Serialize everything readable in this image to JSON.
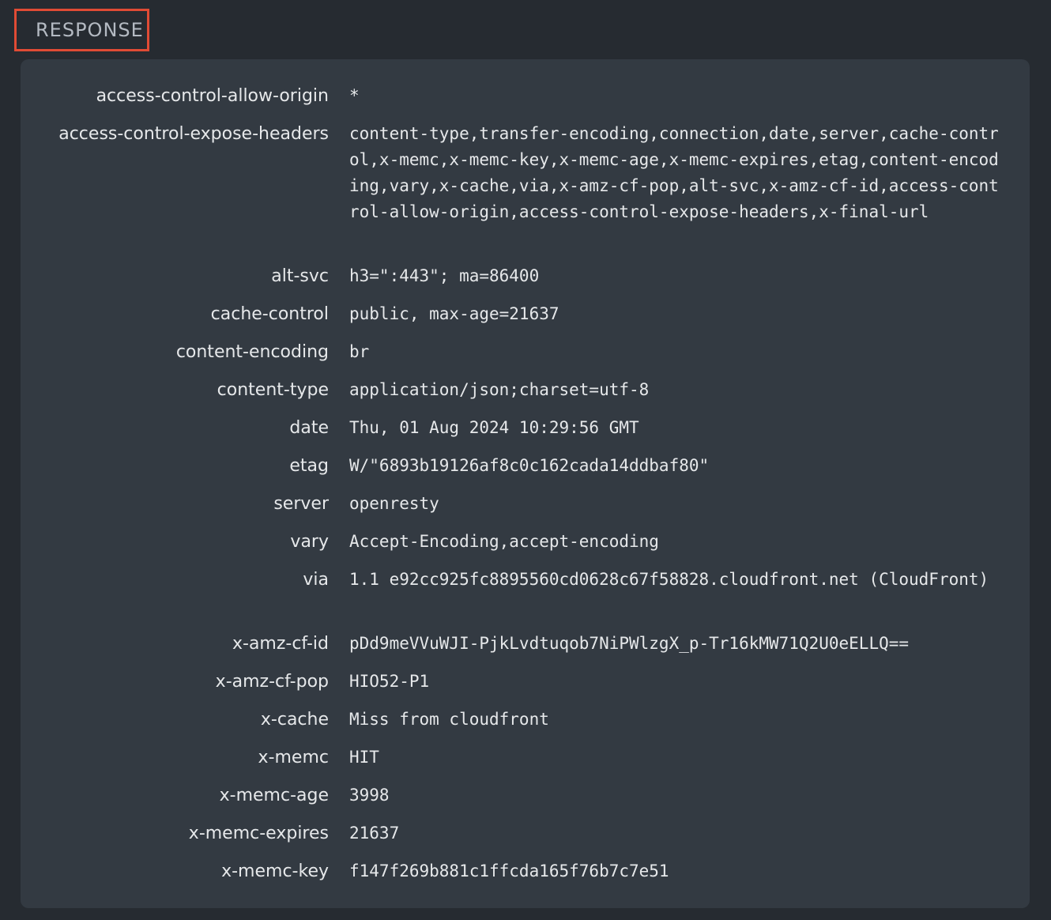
{
  "section": {
    "title": "RESPONSE"
  },
  "headers": [
    {
      "key": "access-control-allow-origin",
      "value": "*"
    },
    {
      "key": "access-control-expose-headers",
      "value": "content-type,transfer-encoding,connection,date,server,cache-control,x-memc,x-memc-key,x-memc-age,x-memc-expires,etag,content-encoding,vary,x-cache,via,x-amz-cf-pop,alt-svc,x-amz-cf-id,access-control-allow-origin,access-control-expose-headers,x-final-url"
    },
    {
      "key": "alt-svc",
      "value": "h3=\":443\"; ma=86400"
    },
    {
      "key": "cache-control",
      "value": "public, max-age=21637"
    },
    {
      "key": "content-encoding",
      "value": "br"
    },
    {
      "key": "content-type",
      "value": "application/json;charset=utf-8"
    },
    {
      "key": "date",
      "value": "Thu, 01 Aug 2024 10:29:56 GMT"
    },
    {
      "key": "etag",
      "value": "W/\"6893b19126af8c0c162cada14ddbaf80\""
    },
    {
      "key": "server",
      "value": "openresty"
    },
    {
      "key": "vary",
      "value": "Accept-Encoding,accept-encoding"
    },
    {
      "key": "via",
      "value": "1.1 e92cc925fc8895560cd0628c67f58828.cloudfront.net (CloudFront)"
    },
    {
      "key": "x-amz-cf-id",
      "value": "pDd9meVVuWJI-PjkLvdtuqob7NiPWlzgX_p-Tr16kMW71Q2U0eELLQ=="
    },
    {
      "key": "x-amz-cf-pop",
      "value": "HIO52-P1"
    },
    {
      "key": "x-cache",
      "value": "Miss from cloudfront"
    },
    {
      "key": "x-memc",
      "value": "HIT"
    },
    {
      "key": "x-memc-age",
      "value": "3998"
    },
    {
      "key": "x-memc-expires",
      "value": "21637"
    },
    {
      "key": "x-memc-key",
      "value": "f147f269b881c1ffcda165f76b7c7e51"
    }
  ]
}
